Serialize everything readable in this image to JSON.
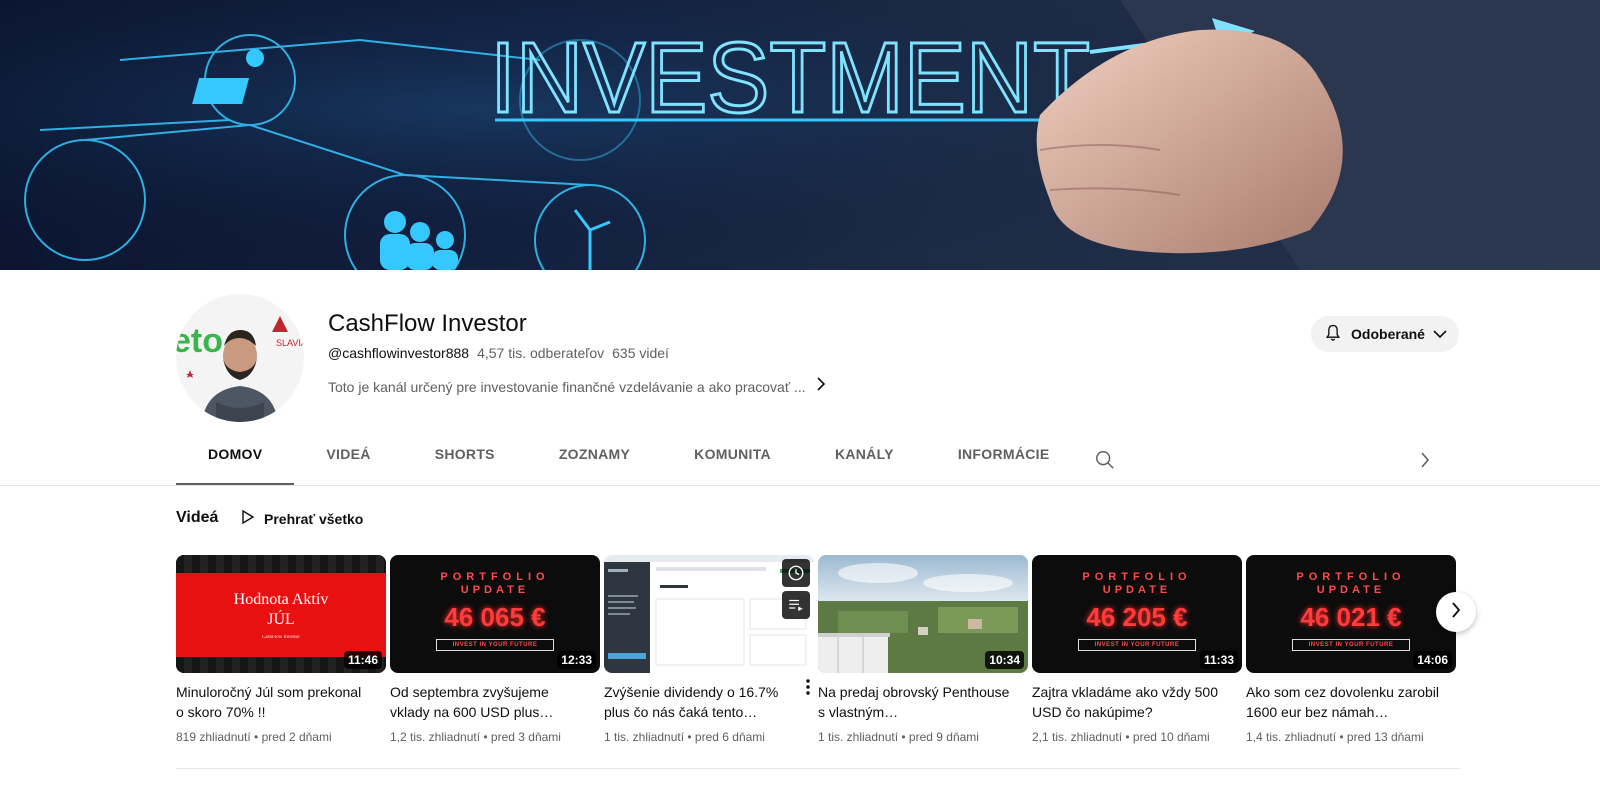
{
  "banner": {
    "text": "INVESTMENT"
  },
  "channel": {
    "name": "CashFlow Investor",
    "handle": "@cashflowinvestor888",
    "subscribers": "4,57 tis. odberateľov",
    "videos_count": "635 videí",
    "description": "Toto je kanál určený pre investovanie finančné vzdelávanie a ako pracovať ..."
  },
  "subscribe_button": {
    "label": "Odoberané"
  },
  "tabs": [
    {
      "label": "DOMOV"
    },
    {
      "label": "VIDEÁ"
    },
    {
      "label": "SHORTS"
    },
    {
      "label": "ZOZNAMY"
    },
    {
      "label": "KOMUNITA"
    },
    {
      "label": "KANÁLY"
    },
    {
      "label": "INFORMÁCIE"
    }
  ],
  "section": {
    "title": "Videá",
    "play_all": "Prehrať všetko"
  },
  "videos": [
    {
      "title": "Minuloročný Júl som prekonal o skoro 70% !!",
      "stats": "819 zhliadnutí • pred 2 dňami",
      "duration": "11:46",
      "thumb": {
        "line1": "Hodnota Aktív",
        "line2": "JÚL",
        "line3": "CashFlow Investor"
      }
    },
    {
      "title": "Od septembra zvyšujeme vklady na 600 USD plus…",
      "stats": "1,2 tis. zhliadnutí • pred 3 dňami",
      "duration": "12:33",
      "thumb": {
        "line1": "PORTFOLIO",
        "line2": "UPDATE",
        "amount": "46 065 €",
        "tag": "INVEST IN YOUR FUTURE"
      }
    },
    {
      "title": "Zvýšenie dividendy o 16.7% plus čo nás čaká tento…",
      "stats": "1 tis. zhliadnutí • pred 6 dňami",
      "duration": ""
    },
    {
      "title": "Na predaj obrovský Penthouse s vlastným…",
      "stats": "1 tis. zhliadnutí • pred 9 dňami",
      "duration": "10:34"
    },
    {
      "title": "Zajtra vkladáme ako vždy 500 USD čo nakúpime?",
      "stats": "2,1 tis. zhliadnutí • pred 10 dňami",
      "duration": "11:33",
      "thumb": {
        "line1": "PORTFOLIO",
        "line2": "UPDATE",
        "amount": "46 205 €",
        "tag": "INVEST IN YOUR FUTURE"
      }
    },
    {
      "title": "Ako som cez dovolenku zarobil 1600 eur bez námah…",
      "stats": "1,4 tis. zhliadnutí • pred 13 dňami",
      "duration": "14:06",
      "thumb": {
        "line1": "PORTFOLIO",
        "line2": "UPDATE",
        "amount": "46 021 €",
        "tag": "INVEST IN YOUR FUTURE"
      }
    }
  ],
  "colors": {
    "accent_red": "#ff3b3b",
    "tab_underline": "#606060",
    "banner_glow": "#35c8ff"
  },
  "icons": {
    "bell": "bell-icon",
    "chevron": "chevron-down-icon",
    "search": "search-icon",
    "play": "play-icon"
  }
}
